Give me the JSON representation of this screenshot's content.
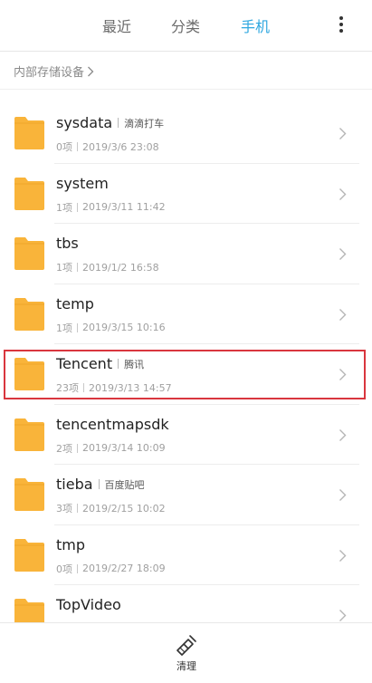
{
  "tabs": [
    {
      "label": "最近"
    },
    {
      "label": "分类"
    },
    {
      "label": "手机"
    }
  ],
  "active_tab": "手机",
  "accent_color": "#2ea7e0",
  "folder_color": "#f9b43a",
  "breadcrumb": {
    "label": "内部存储设备"
  },
  "files": [
    {
      "name": "sysdata",
      "tag": "滴滴打车",
      "count": "0项",
      "date": "2019/3/6 23:08"
    },
    {
      "name": "system",
      "tag": "",
      "count": "1项",
      "date": "2019/3/11 11:42"
    },
    {
      "name": "tbs",
      "tag": "",
      "count": "1项",
      "date": "2019/1/2 16:58"
    },
    {
      "name": "temp",
      "tag": "",
      "count": "1项",
      "date": "2019/3/15 10:16"
    },
    {
      "name": "Tencent",
      "tag": "腾讯",
      "count": "23项",
      "date": "2019/3/13 14:57"
    },
    {
      "name": "tencentmapsdk",
      "tag": "",
      "count": "2项",
      "date": "2019/3/14 10:09"
    },
    {
      "name": "tieba",
      "tag": "百度贴吧",
      "count": "3项",
      "date": "2019/2/15 10:02"
    },
    {
      "name": "tmp",
      "tag": "",
      "count": "0项",
      "date": "2019/2/27 18:09"
    },
    {
      "name": "TopVideo",
      "tag": "",
      "count": "",
      "date": ""
    }
  ],
  "bottom": {
    "clean_label": "清理",
    "clean_icon": "broom-icon"
  }
}
